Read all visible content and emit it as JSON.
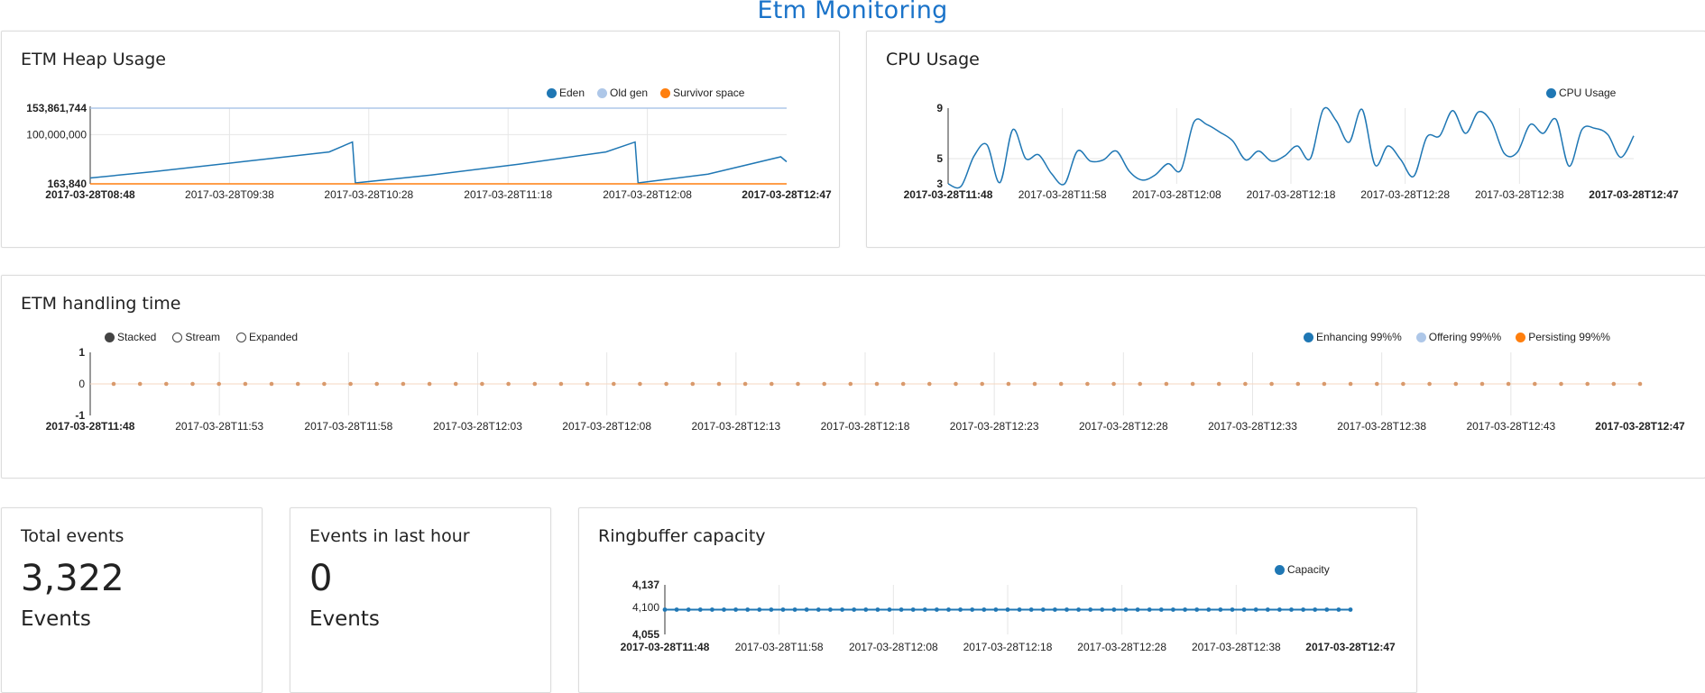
{
  "page": {
    "title": "Etm Monitoring"
  },
  "heap": {
    "title": "ETM Heap Usage",
    "legend": [
      {
        "label": "Eden",
        "color": "#1f77b4"
      },
      {
        "label": "Old gen",
        "color": "#aec7e8"
      },
      {
        "label": "Survivor space",
        "color": "#ff7f0e"
      }
    ],
    "y_ticks": [
      "153,861,744",
      "100,000,000",
      "163,840"
    ],
    "x_ticks": [
      "2017-03-28T08:48",
      "2017-03-28T09:38",
      "2017-03-28T10:28",
      "2017-03-28T11:18",
      "2017-03-28T12:08",
      "2017-03-28T12:47"
    ]
  },
  "cpu": {
    "title": "CPU Usage",
    "legend": [
      {
        "label": "CPU Usage",
        "color": "#1f77b4"
      }
    ],
    "y_ticks": [
      "9",
      "5",
      "3"
    ],
    "x_ticks": [
      "2017-03-28T11:48",
      "2017-03-28T11:58",
      "2017-03-28T12:08",
      "2017-03-28T12:18",
      "2017-03-28T12:28",
      "2017-03-28T12:38",
      "2017-03-28T12:47"
    ]
  },
  "handling": {
    "title": "ETM handling time",
    "modes": [
      {
        "label": "Stacked",
        "selected": true
      },
      {
        "label": "Stream",
        "selected": false
      },
      {
        "label": "Expanded",
        "selected": false
      }
    ],
    "legend": [
      {
        "label": "Enhancing 99%%",
        "color": "#1f77b4"
      },
      {
        "label": "Offering 99%%",
        "color": "#aec7e8"
      },
      {
        "label": "Persisting 99%%",
        "color": "#ff7f0e"
      }
    ],
    "y_ticks": [
      "1",
      "0",
      "-1"
    ],
    "x_ticks": [
      "2017-03-28T11:48",
      "2017-03-28T11:53",
      "2017-03-28T11:58",
      "2017-03-28T12:03",
      "2017-03-28T12:08",
      "2017-03-28T12:13",
      "2017-03-28T12:18",
      "2017-03-28T12:23",
      "2017-03-28T12:28",
      "2017-03-28T12:33",
      "2017-03-28T12:38",
      "2017-03-28T12:43",
      "2017-03-28T12:47"
    ]
  },
  "total_events": {
    "title": "Total events",
    "value": "3,322",
    "unit": "Events"
  },
  "last_hour": {
    "title": "Events in last hour",
    "value": "0",
    "unit": "Events"
  },
  "ringbuffer": {
    "title": "Ringbuffer capacity",
    "legend": [
      {
        "label": "Capacity",
        "color": "#1f77b4"
      }
    ],
    "y_ticks": [
      "4,137",
      "4,100",
      "4,055"
    ],
    "x_ticks": [
      "2017-03-28T11:48",
      "2017-03-28T11:58",
      "2017-03-28T12:08",
      "2017-03-28T12:18",
      "2017-03-28T12:28",
      "2017-03-28T12:38",
      "2017-03-28T12:47"
    ]
  },
  "chart_data": [
    {
      "type": "line",
      "title": "ETM Heap Usage",
      "ylim": [
        163840,
        153861744
      ],
      "x_range": [
        "2017-03-28T08:48",
        "2017-03-28T12:47"
      ],
      "series": [
        {
          "name": "Eden",
          "color": "#1f77b4",
          "x": [
            "2017-03-28T08:48",
            "2017-03-28T09:10",
            "2017-03-28T09:40",
            "2017-03-28T10:10",
            "2017-03-28T10:18",
            "2017-03-28T10:19",
            "2017-03-28T10:45",
            "2017-03-28T11:15",
            "2017-03-28T11:45",
            "2017-03-28T11:55",
            "2017-03-28T11:56",
            "2017-03-28T12:20",
            "2017-03-28T12:45",
            "2017-03-28T12:47"
          ],
          "values": [
            12000000,
            25000000,
            45000000,
            65000000,
            85000000,
            2000000,
            18000000,
            40000000,
            65000000,
            85000000,
            2000000,
            20000000,
            55000000,
            45000000
          ]
        },
        {
          "name": "Old gen",
          "color": "#aec7e8",
          "x": [
            "2017-03-28T08:48",
            "2017-03-28T12:47"
          ],
          "values": [
            153861744,
            153861744
          ]
        },
        {
          "name": "Survivor space",
          "color": "#ff7f0e",
          "x": [
            "2017-03-28T08:48",
            "2017-03-28T12:47"
          ],
          "values": [
            163840,
            163840
          ]
        }
      ]
    },
    {
      "type": "line",
      "title": "CPU Usage",
      "ylim": [
        3,
        9
      ],
      "x_range": [
        "2017-03-28T11:48",
        "2017-03-28T12:47"
      ],
      "series": [
        {
          "name": "CPU Usage",
          "color": "#1f77b4",
          "values": [
            3.0,
            2.8,
            5.2,
            6.1,
            3.1,
            7.3,
            5.0,
            5.3,
            3.8,
            3.0,
            5.6,
            4.8,
            4.9,
            5.6,
            4.0,
            3.3,
            3.7,
            4.6,
            4.1,
            7.9,
            7.7,
            7.1,
            6.4,
            4.9,
            5.6,
            4.8,
            5.2,
            6.0,
            5.0,
            8.9,
            8.0,
            6.3,
            8.9,
            4.5,
            6.0,
            4.9,
            3.6,
            6.7,
            6.8,
            8.8,
            7.0,
            8.7,
            7.9,
            5.4,
            5.5,
            7.7,
            7.0,
            8.1,
            4.4,
            7.3,
            7.4,
            6.9,
            5.1,
            6.8
          ]
        }
      ]
    },
    {
      "type": "line",
      "title": "ETM handling time",
      "ylim": [
        -1,
        1
      ],
      "x_range": [
        "2017-03-28T11:48",
        "2017-03-28T12:47"
      ],
      "series": [
        {
          "name": "Persisting 99%%",
          "color": "#ff7f0e",
          "constant": 0,
          "points": 59
        }
      ]
    },
    {
      "type": "line",
      "title": "Ringbuffer capacity",
      "ylim": [
        4055,
        4137
      ],
      "x_range": [
        "2017-03-28T11:48",
        "2017-03-28T12:47"
      ],
      "series": [
        {
          "name": "Capacity",
          "color": "#1f77b4",
          "constant": 4096,
          "points": 59
        }
      ]
    }
  ]
}
